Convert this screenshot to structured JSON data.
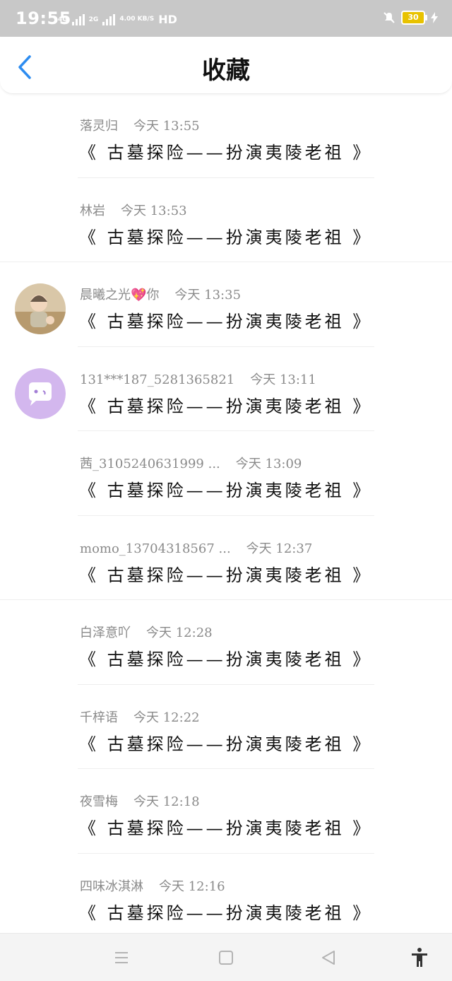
{
  "status": {
    "time": "19:55",
    "network_a": "4G",
    "network_b": "2G",
    "speed": "4.00 KB/S",
    "hd": "HD",
    "battery": "30"
  },
  "header": {
    "title": "收藏"
  },
  "items": [
    {
      "user": "落灵归",
      "time": "今天 13:55",
      "title": "《 古墓探险——扮演夷陵老祖 》"
    },
    {
      "user": "林岩",
      "time": "今天 13:53",
      "title": "《 古墓探险——扮演夷陵老祖 》"
    },
    {
      "user": "晨曦之光💖你",
      "time": "今天 13:35",
      "title": "《 古墓探险——扮演夷陵老祖 》"
    },
    {
      "user": "131***187_5281365821",
      "time": "今天 13:11",
      "title": "《 古墓探险——扮演夷陵老祖 》"
    },
    {
      "user": "茜_3105240631999 ...",
      "time": "今天 13:09",
      "title": "《 古墓探险——扮演夷陵老祖 》"
    },
    {
      "user": "momo_13704318567 ...",
      "time": "今天 12:37",
      "title": "《 古墓探险——扮演夷陵老祖 》"
    },
    {
      "user": "白泽意吖",
      "time": "今天 12:28",
      "title": "《 古墓探险——扮演夷陵老祖 》"
    },
    {
      "user": "千梓语",
      "time": "今天 12:22",
      "title": "《 古墓探险——扮演夷陵老祖 》"
    },
    {
      "user": "夜雪梅",
      "time": "今天 12:18",
      "title": "《 古墓探险——扮演夷陵老祖 》"
    },
    {
      "user": "四味冰淇淋",
      "time": "今天 12:16",
      "title": "《 古墓探险——扮演夷陵老祖 》"
    }
  ],
  "colors": {
    "accent": "#2d8cf0",
    "status_bg": "#c8c8c8",
    "battery": "#e8c200"
  },
  "icons": {
    "back": "chevron-left-icon",
    "menu": "menu-icon",
    "home": "home-icon",
    "nav_back": "triangle-back-icon",
    "accessibility": "accessibility-icon"
  }
}
